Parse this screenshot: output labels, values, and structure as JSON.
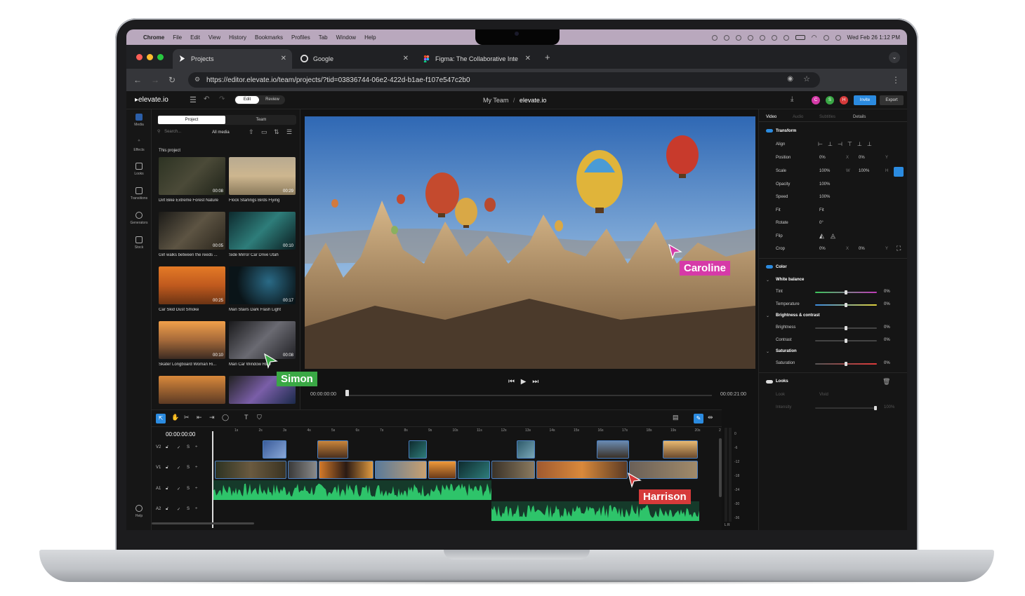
{
  "menubar": {
    "app": "Chrome",
    "items": [
      "File",
      "Edit",
      "View",
      "History",
      "Bookmarks",
      "Profiles",
      "Tab",
      "Window",
      "Help"
    ],
    "clock": "Wed Feb 26  1:12 PM"
  },
  "browser": {
    "tabs": [
      {
        "title": "Projects",
        "icon": "elevate-icon"
      },
      {
        "title": "Google",
        "icon": "google-icon"
      },
      {
        "title": "Figma: The Collaborative Inte",
        "icon": "figma-icon"
      }
    ],
    "new_tab": "+",
    "url": "https://editor.elevate.io/team/projects/?tid=03836744-06e2-422d-b1ae-f107e547c2b0"
  },
  "app": {
    "logo": "elevate.io",
    "mode_edit": "Edit",
    "mode_review": "Review",
    "breadcrumb_team": "My Team",
    "breadcrumb_sep": "/",
    "breadcrumb_project": "elevate.io",
    "avatars": [
      {
        "letter": "C",
        "color": "#d63aa8"
      },
      {
        "letter": "S",
        "color": "#3aa845"
      },
      {
        "letter": "H",
        "color": "#d63a3a"
      }
    ],
    "invite": "Invite",
    "export": "Export"
  },
  "rail": [
    {
      "label": "Media"
    },
    {
      "label": "Effects"
    },
    {
      "label": "Looks"
    },
    {
      "label": "Transitions"
    },
    {
      "label": "Generators"
    },
    {
      "label": "Stock"
    }
  ],
  "rail_help": "Help",
  "media": {
    "tab_project": "Project",
    "tab_team": "Team",
    "search_placeholder": "Search...",
    "filter": "All media",
    "section": "This project",
    "items": [
      {
        "title": "Dirt Bike Extreme Forest Nature",
        "duration": "00:08"
      },
      {
        "title": "Flock Starlings Birds Flying",
        "duration": "00:29"
      },
      {
        "title": "Girl walks between the reeds ...",
        "duration": "00:05"
      },
      {
        "title": "Side Mirror Car Drive Utah",
        "duration": "00:10"
      },
      {
        "title": "Car Skid Dust Smoke",
        "duration": "00:25"
      },
      {
        "title": "Man Stairs Dark Flash Light",
        "duration": "00:17"
      },
      {
        "title": "Skater Longboard Woman Ri...",
        "duration": "00:10"
      },
      {
        "title": "Man Car Window Ride",
        "duration": "00:08"
      }
    ]
  },
  "viewer": {
    "current_time": "00:00:00:00",
    "total_time": "00:00:21:00",
    "playhead_fraction": 0
  },
  "inspector": {
    "tabs": [
      "Video",
      "Audio",
      "Subtitles",
      "Details"
    ],
    "transform": "Transform",
    "rows": [
      {
        "label": "Align",
        "v1": "",
        "v2": ""
      },
      {
        "label": "Position",
        "v1": "0%",
        "k2": "X",
        "v2": "0%",
        "k3": "Y"
      },
      {
        "label": "Scale",
        "v1": "100%",
        "k2": "W",
        "v2": "100%",
        "k3": "H"
      },
      {
        "label": "Opacity",
        "v1": "100%"
      },
      {
        "label": "Speed",
        "v1": "100%"
      },
      {
        "label": "Fit",
        "v1": "Fit"
      },
      {
        "label": "Rotate",
        "v1": "0°"
      },
      {
        "label": "Flip",
        "v1": ""
      },
      {
        "label": "Crop",
        "v1": "0%",
        "k2": "X",
        "v2": "0%",
        "k3": "Y"
      }
    ],
    "color": "Color",
    "white_balance": "White balance",
    "tint": {
      "label": "Tint",
      "value": "0%"
    },
    "temperature": {
      "label": "Temperature",
      "value": "0%"
    },
    "bc": "Brightness & contrast",
    "brightness": {
      "label": "Brightness",
      "value": "0%"
    },
    "contrast": {
      "label": "Contrast",
      "value": "0%"
    },
    "saturation_group": "Saturation",
    "saturation": {
      "label": "Saturation",
      "value": "0%"
    },
    "looks": "Looks",
    "look_label": "Look",
    "look_value": "Vivid",
    "intensity_label": "Intensity",
    "intensity_value": "100%"
  },
  "timeline": {
    "timecode": "00:00:00:00",
    "ruler": [
      "1s",
      "2s",
      "3s",
      "4s",
      "5s",
      "6s",
      "7s",
      "8s",
      "9s",
      "10s",
      "11s",
      "12s",
      "13s",
      "14s",
      "15s",
      "16s",
      "17s",
      "18s",
      "19s",
      "20s",
      "2"
    ],
    "tracks": [
      {
        "name": "V2",
        "s": "S"
      },
      {
        "name": "V1",
        "s": "S"
      },
      {
        "name": "A1",
        "s": "S"
      },
      {
        "name": "A2",
        "s": "S"
      }
    ],
    "meter": [
      "0",
      "-6",
      "-12",
      "-18",
      "-24",
      "-30",
      "-36",
      "dB"
    ],
    "meter_lr": "L  R"
  },
  "cursors": {
    "caroline": {
      "name": "Caroline",
      "color": "#d63aa8"
    },
    "simon": {
      "name": "Simon",
      "color": "#3aa845"
    },
    "harrison": {
      "name": "Harrison",
      "color": "#d63a3a"
    }
  }
}
